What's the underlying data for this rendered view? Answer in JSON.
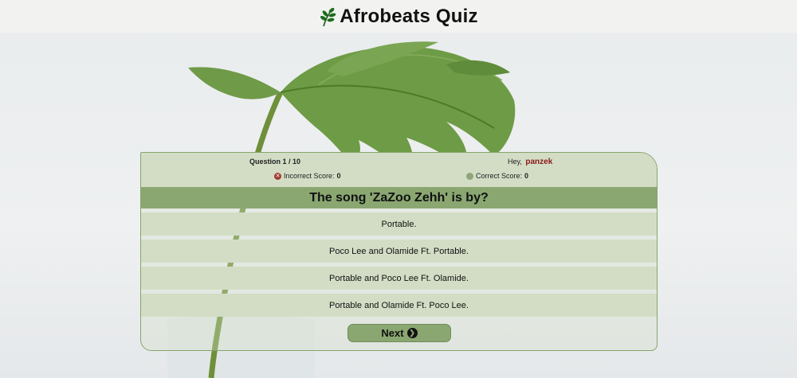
{
  "app": {
    "title": "Afrobeats Quiz",
    "logo_icon": "leaf-icon"
  },
  "status": {
    "question_label": "Question 1 / 10",
    "greeting": "Hey,",
    "username": "panzek",
    "incorrect_label": "Incorrect Score:",
    "incorrect_value": "0",
    "correct_label": "Correct Score:",
    "correct_value": "0"
  },
  "question": {
    "text": "The song 'ZaZoo Zehh' is by?"
  },
  "options": [
    "Portable.",
    "Poco Lee and Olamide Ft. Portable.",
    "Portable and Poco Lee Ft. Olamide.",
    "Portable and Olamide Ft. Poco Lee."
  ],
  "next": {
    "label": "Next",
    "icon": "arrow-right-circle-icon"
  },
  "colors": {
    "accent": "#8aa771",
    "panel": "#d3ddc5",
    "username": "#8a1a1a",
    "incorrect": "#a33a30",
    "correct": "#8ea67a"
  }
}
